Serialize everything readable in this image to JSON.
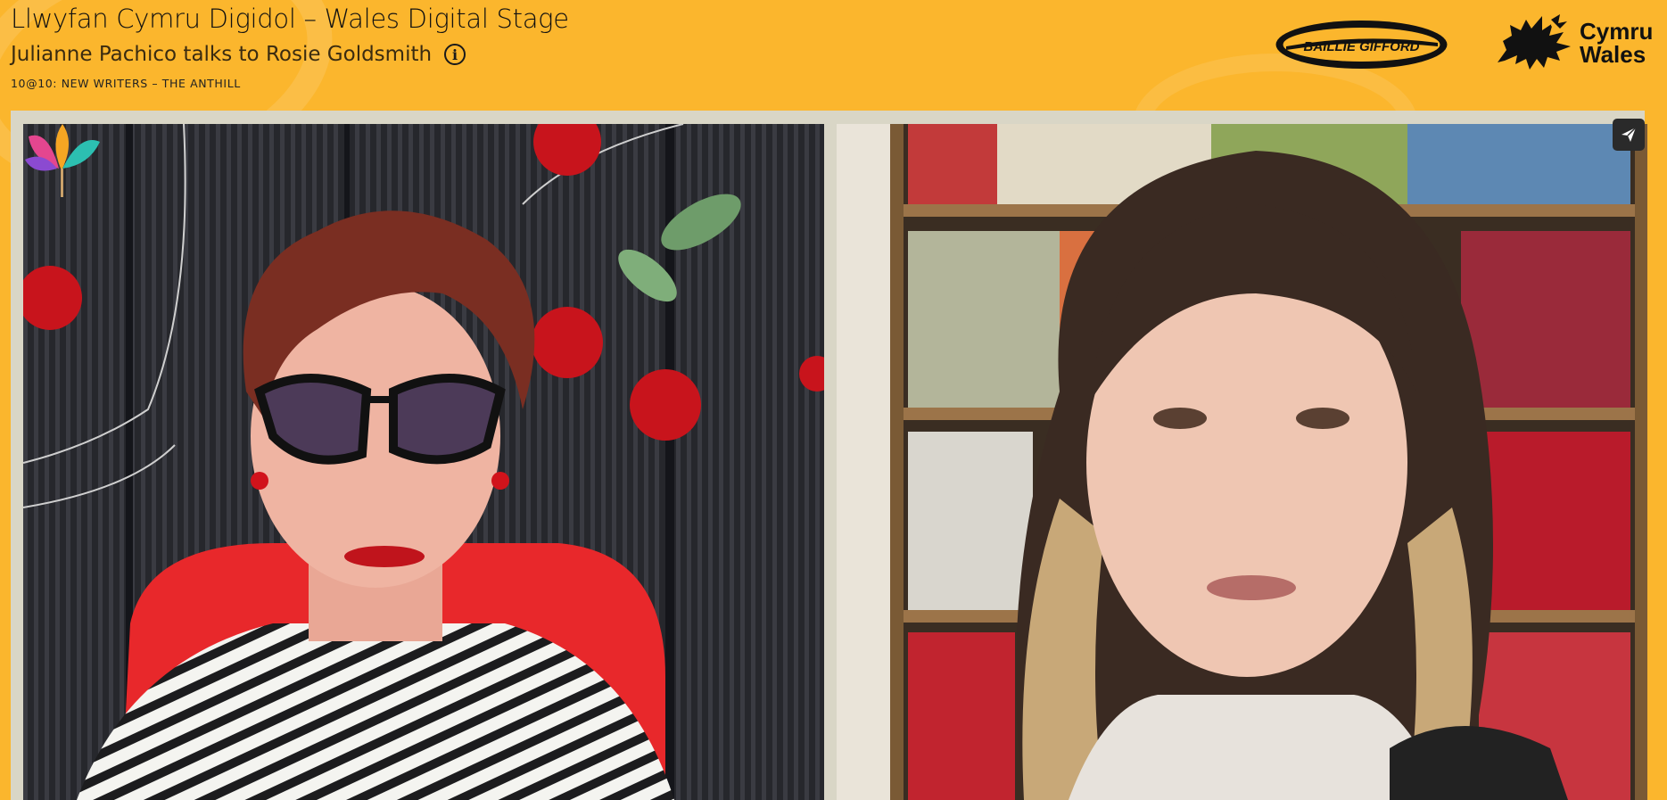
{
  "header": {
    "title": "Llwyfan Cymru Digidol – Wales Digital Stage",
    "subtitle": "Julianne Pachico talks to Rosie Goldsmith",
    "info_glyph": "i",
    "series_label": "10@10: NEW WRITERS – THE ANTHILL"
  },
  "sponsors": {
    "baillie_gifford": "BAILLIE GIFFORD",
    "cymru_wales_line1": "Cymru",
    "cymru_wales_line2": "Wales"
  },
  "video": {
    "participants": [
      {
        "tile": "left",
        "description_icon": "participant-video"
      },
      {
        "tile": "right",
        "description_icon": "participant-video"
      }
    ]
  },
  "icons": {
    "info": "info-icon",
    "share": "send-icon",
    "festival": "festival-fan-logo",
    "dragon": "welsh-dragon-icon"
  },
  "colors": {
    "accent": "#fbb62d",
    "stage": "#d9d6c6",
    "button": "#2a2a2a"
  }
}
